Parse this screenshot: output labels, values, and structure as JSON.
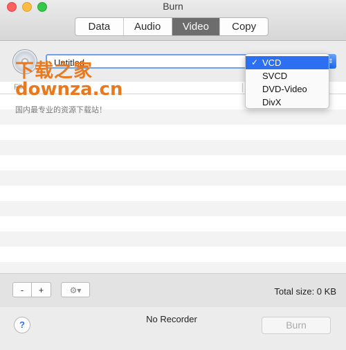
{
  "window": {
    "title": "Burn"
  },
  "tabs": [
    {
      "label": "Data",
      "active": false
    },
    {
      "label": "Audio",
      "active": false
    },
    {
      "label": "Video",
      "active": true
    },
    {
      "label": "Copy",
      "active": false
    }
  ],
  "disc": {
    "name_value": "Untitled",
    "icon": "disc-icon"
  },
  "type_menu": {
    "items": [
      {
        "label": "VCD",
        "selected": true
      },
      {
        "label": "SVCD",
        "selected": false
      },
      {
        "label": "DVD-Video",
        "selected": false
      },
      {
        "label": "DivX",
        "selected": false
      }
    ],
    "check_mark": "✓"
  },
  "list": {
    "header_label": "File"
  },
  "watermark": {
    "logo": "下载之家",
    "url": "downza.cn",
    "tagline": "国内最专业的资源下载站！"
  },
  "bottom_bar": {
    "remove_label": "-",
    "add_label": "+",
    "action_icon": "gear-icon",
    "total_size": "Total size: 0 KB"
  },
  "footer": {
    "help_label": "?",
    "recorder_status": "No Recorder",
    "burn_label": "Burn"
  },
  "colors": {
    "accent": "#2c6ff1",
    "watermark": "#e8791f",
    "active_tab": "#6d6d6d"
  }
}
